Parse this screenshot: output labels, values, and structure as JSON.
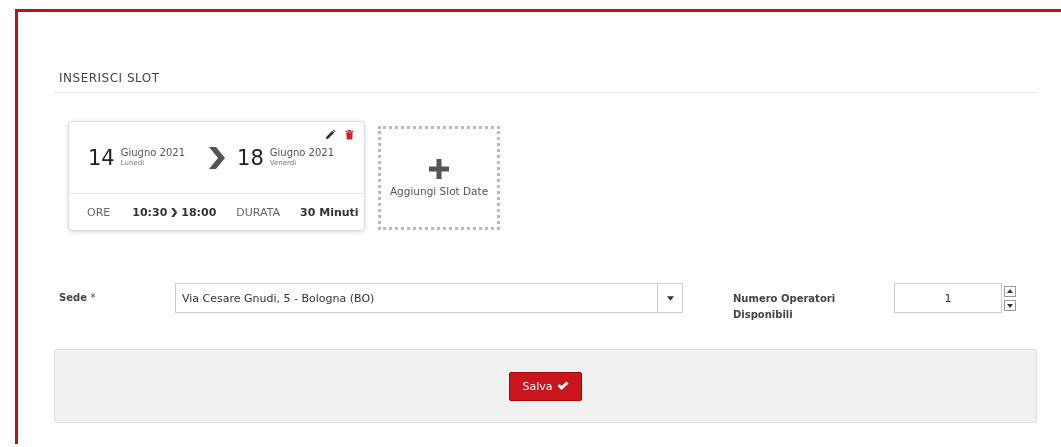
{
  "section_title": "INSERISCI SLOT",
  "slots": [
    {
      "start_day": "14",
      "start_month": "Giugno 2021",
      "start_weekday": "Lunedì",
      "end_day": "18",
      "end_month": "Giugno 2021",
      "end_weekday": "Venerdì",
      "hours_label": "ORE",
      "hours_start": "10:30",
      "hours_end": "18:00",
      "duration_label": "DURATA",
      "duration": "30 Minuti"
    }
  ],
  "add_slot": {
    "label": "Aggiungi Slot Date"
  },
  "sede": {
    "label": "Sede",
    "required_mark": "*",
    "value": "Via Cesare Gnudi, 5 - Bologna (BO)"
  },
  "operators": {
    "label": "Numero Operatori Disponibili",
    "value": "1"
  },
  "save_button": {
    "label": "Salva"
  }
}
